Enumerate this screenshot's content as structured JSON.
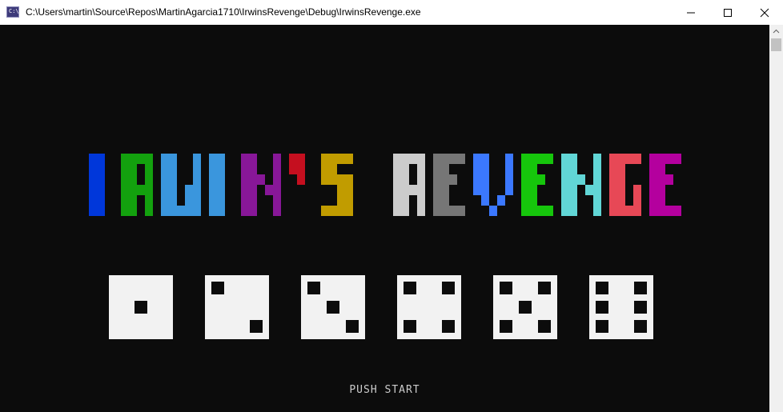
{
  "window": {
    "title": "C:\\Users\\martin\\Source\\Repos\\MartinAgarcia1710\\IrwinsRevenge\\Debug\\IrwinsRevenge.exe",
    "icon": "console-app-icon",
    "icon_text": "C:\\"
  },
  "game": {
    "logo_text": "IRWIN'S REVENGE",
    "logo_colors": [
      "#0037da",
      "#13a10e",
      "#3a96dd",
      "#3a96dd",
      "#881798",
      "#c50f1f",
      "#c19c00",
      "#cccccc",
      "#767676",
      "#3b78ff",
      "#16c60c",
      "#61d6d6",
      "#e74856",
      "#b4009e",
      "#f9f1a5"
    ],
    "dice_values": [
      1,
      2,
      3,
      4,
      5,
      6
    ],
    "prompt": "PUSH START"
  },
  "colors": {
    "background": "#0c0c0c",
    "die_face": "#f2f2f2",
    "prompt": "#cccccc"
  }
}
